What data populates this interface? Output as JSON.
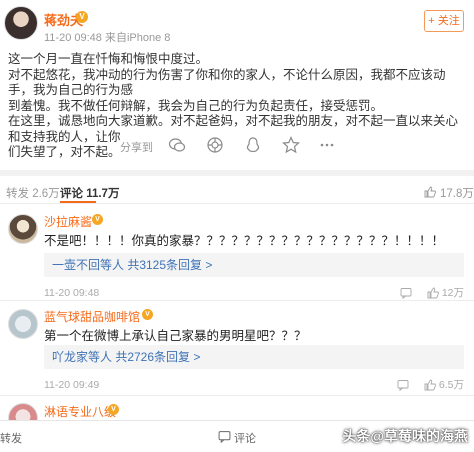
{
  "post": {
    "author": "蒋劲夫",
    "badge": "V",
    "meta": "11-20 09:48  来自iPhone 8",
    "follow_label": "+ 关注",
    "body": [
      "这一个月一直在忏悔和悔恨中度过。",
      "对不起悠花，我冲动的行为伤害了你和你的家人，不论什么原因，我都不应该动手，我为自己的行为感",
      "到羞愧。我不做任何辩解，我会为自己的行为负起责任，接受惩罚。",
      "在这里，诚恳地向大家道歉。对不起爸妈，对不起我的朋友，对不起一直以来关心和支持我的人，让你",
      "们失望了，对不起。"
    ],
    "share_label": "分享到",
    "share_icons": [
      "wechat-icon",
      "moments-icon",
      "qq-icon",
      "qzone-icon",
      "more-icon"
    ]
  },
  "tabs": {
    "repost": "转发 2.6万",
    "comments": "评论 11.7万",
    "likes": "17.8万"
  },
  "comments": [
    {
      "name": "沙拉麻酱",
      "text": "不是吧！！！！你真的家暴？？？？？？？？？？？？？？？？！！！！",
      "reply": "一壶不回等人  共3125条回复 >",
      "time": "11-20 09:48",
      "like": "12万"
    },
    {
      "name": "蓝气球甜品咖啡馆",
      "text": "第一个在微博上承认自己家暴的男明星吧？？？",
      "reply": "吖龙家等人  共2726条回复 >",
      "time": "11-20 09:49",
      "like": "6.5万"
    },
    {
      "name": "淋语专业八级"
    }
  ],
  "bottom_bar": {
    "repost": "转发",
    "comment": "评论"
  },
  "watermark": "头条@草莓味的海燕"
}
